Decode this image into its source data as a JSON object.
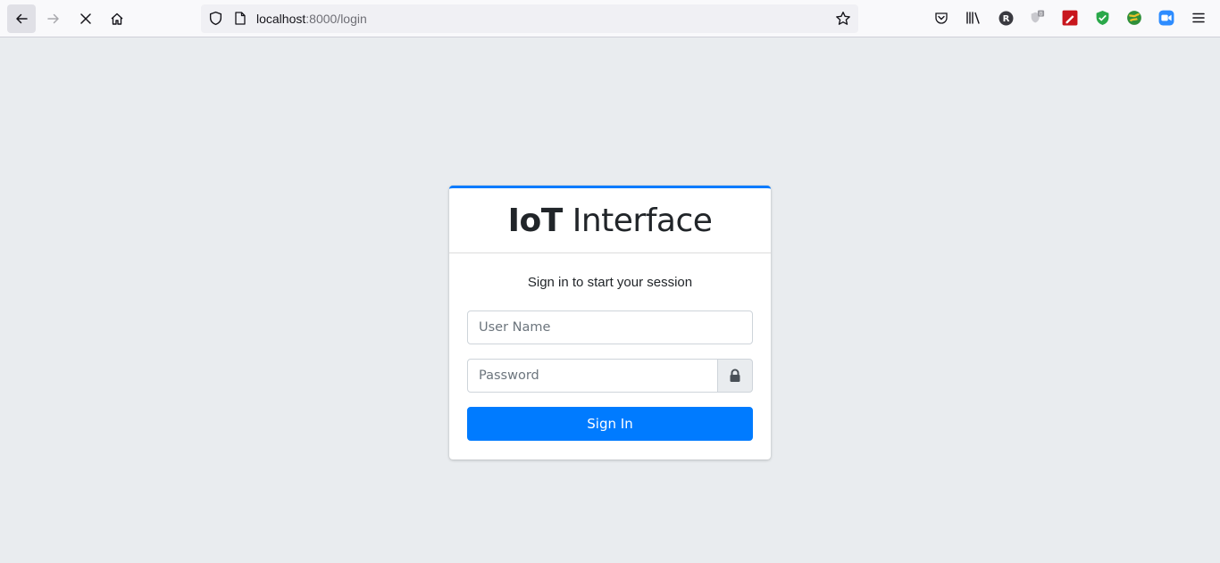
{
  "browser": {
    "url_host": "localhost",
    "url_rest": ":8000/login",
    "icons": {
      "back": "back-arrow-icon",
      "forward": "forward-arrow-icon",
      "stop": "stop-icon",
      "home": "home-icon",
      "tracking": "tracking-shield-icon",
      "page": "page-icon",
      "bookmark": "bookmark-star-icon",
      "pocket": "pocket-icon",
      "library": "library-icon",
      "menu": "hamburger-menu-icon"
    },
    "extensions": [
      {
        "name": "r-extension-icon",
        "text": "R"
      },
      {
        "name": "privacy-badger-icon",
        "badge": "0"
      },
      {
        "name": "red-pen-extension-icon"
      },
      {
        "name": "green-shield-extension-icon"
      },
      {
        "name": "globe-extension-icon"
      },
      {
        "name": "zoom-extension-icon"
      }
    ]
  },
  "login": {
    "brand_bold": "IoT",
    "brand_light": " Interface",
    "message": "Sign in to start your session",
    "username_placeholder": "User Name",
    "password_placeholder": "Password",
    "lock_icon": "lock-icon",
    "signin_label": "Sign In"
  },
  "colors": {
    "accent": "#007bff",
    "page_bg": "#e9ecef"
  }
}
